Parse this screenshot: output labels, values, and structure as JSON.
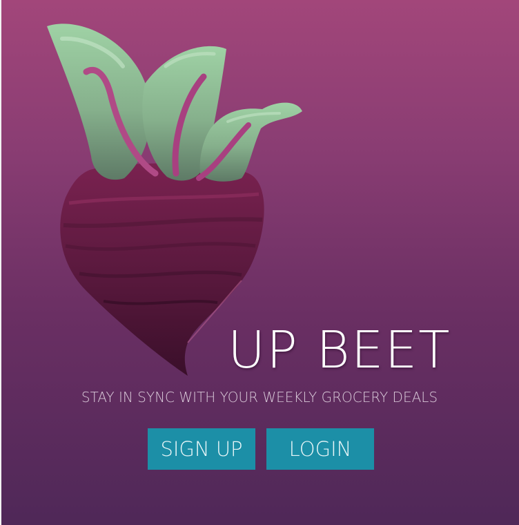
{
  "brand": {
    "title": "UP BEET",
    "tagline": "STAY IN SYNC WITH YOUR WEEKLY GROCERY DEALS",
    "logo_icon": "beet-icon"
  },
  "actions": {
    "signup_label": "SIGN UP",
    "login_label": "LOGIN"
  },
  "colors": {
    "background_top": "#a2467a",
    "background_bottom": "#4f2858",
    "button": "#1c8fa7",
    "button_text": "#e9f6f8",
    "title_text": "#ffffff",
    "tagline_text": "#d9c9d9",
    "beet_root": "#6b1f45",
    "beet_leaves": "#8fbf97"
  }
}
